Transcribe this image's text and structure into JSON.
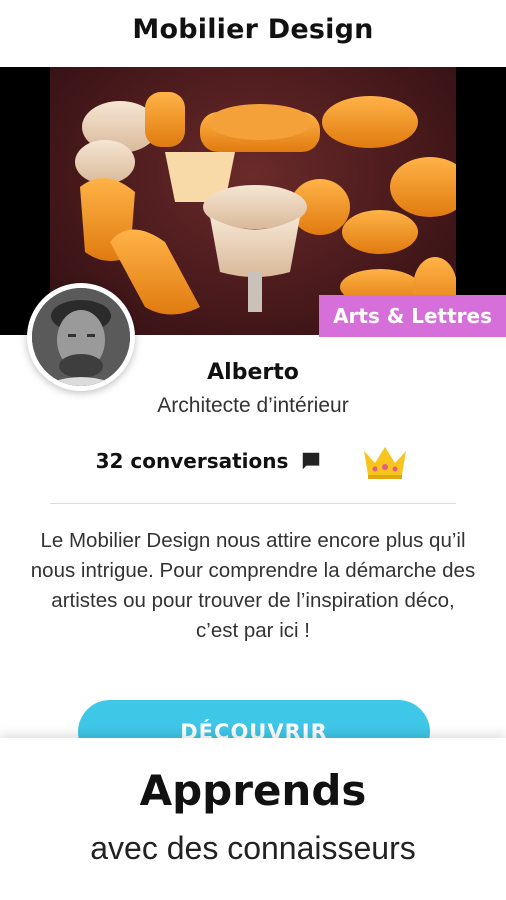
{
  "header": {
    "title": "Mobilier Design"
  },
  "hero": {
    "category_badge": "Arts & Lettres",
    "category_color": "#d66fd9"
  },
  "author": {
    "name": "Alberto",
    "role": "Architecte d’intérieur",
    "conversations": "32 conversations"
  },
  "description": "Le Mobilier Design nous attire encore plus qu’il nous intrigue. Pour comprendre la démarche des artistes ou pour trouver de l’inspiration déco, c’est par ici !",
  "cta": {
    "label": "DÉCOUVRIR",
    "color": "#3fc7e8"
  },
  "footer": {
    "heading": "Apprends",
    "subheading": "avec des connaisseurs"
  },
  "icons": {
    "chat": "chat-bubble-icon",
    "crown": "crown-icon"
  }
}
